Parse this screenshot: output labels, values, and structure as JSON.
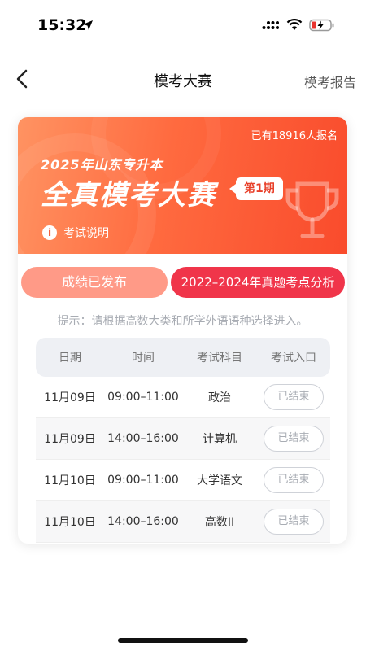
{
  "status_bar": {
    "time": "15:32"
  },
  "nav": {
    "title": "模考大赛",
    "report_label": "模考报告"
  },
  "banner": {
    "enrolled_text": "已有18916人报名",
    "subtitle": "2025年山东专升本",
    "title": "全真模考大赛",
    "issue_badge": "第1期",
    "info_label": "考试说明"
  },
  "buttons": {
    "results_label": "成绩已发布",
    "analysis_label": "2022–2024年真题考点分析"
  },
  "hint": "提示：请根据高数大类和所学外语语种选择进入。",
  "table": {
    "headers": [
      "日期",
      "时间",
      "考试科目",
      "考试入口"
    ],
    "rows": [
      {
        "date": "11月09日",
        "time": "09:00–11:00",
        "subject": "政治",
        "entry": "已结束"
      },
      {
        "date": "11月09日",
        "time": "14:00–16:00",
        "subject": "计算机",
        "entry": "已结束"
      },
      {
        "date": "11月10日",
        "time": "09:00–11:00",
        "subject": "大学语文",
        "entry": "已结束"
      },
      {
        "date": "11月10日",
        "time": "14:00–16:00",
        "subject": "高数II",
        "entry": "已结束"
      }
    ]
  }
}
